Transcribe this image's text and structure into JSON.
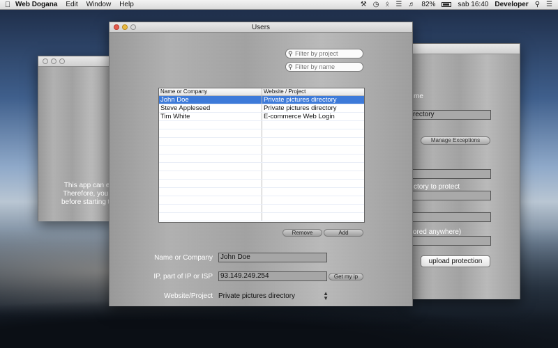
{
  "menubar": {
    "app_name": "Web Dogana",
    "menus": [
      "Edit",
      "Window",
      "Help"
    ],
    "battery": "82%",
    "clock": "sab 16:40",
    "user": "Developer"
  },
  "left_window": {
    "lines": [
      "This app can ed",
      "Therefore, you s",
      "before starting to"
    ]
  },
  "right_window": {
    "label_name": "me",
    "field_directory": "rectory",
    "manage_exceptions": "Manage Exceptions",
    "label_directory": "ctory to protect",
    "label_stored": "tored anywhere)",
    "upload_button": "upload protection"
  },
  "users_window": {
    "title": "Users",
    "filter_project_placeholder": "Filter by project",
    "filter_name_placeholder": "Filter by name",
    "table": {
      "columns": [
        "Name or Company",
        "Website / Project"
      ],
      "rows": [
        {
          "name": "John Doe",
          "project": "Private pictures directory"
        },
        {
          "name": "Steve Appleseed",
          "project": "Private pictures directory"
        },
        {
          "name": "Tim White",
          "project": "E-commerce Web Login"
        }
      ]
    },
    "remove_button": "Remove",
    "add_button": "Add",
    "form": {
      "name_label": "Name or Company",
      "name_value": "John Doe",
      "ip_label": "IP, part of IP or ISP",
      "ip_value": "93.149.249.254",
      "get_ip_button": "Get my ip",
      "website_label": "Website/Project",
      "website_value": "Private pictures directory"
    }
  }
}
